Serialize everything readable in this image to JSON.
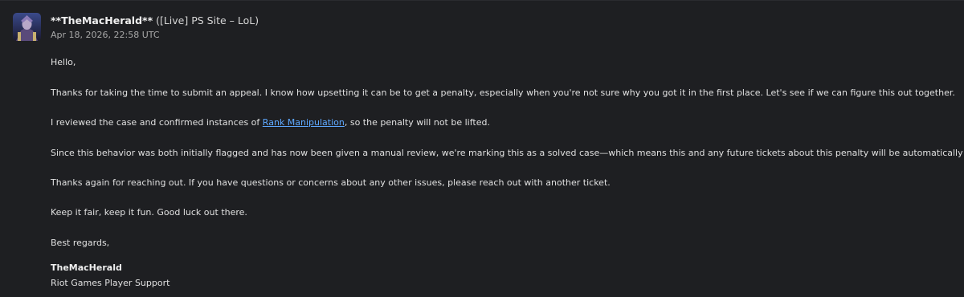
{
  "message": {
    "author": "**TheMacHerald**",
    "site": "([Live] PS Site – LoL)",
    "timestamp": "Apr 18, 2026, 22:58 UTC",
    "avatar_icon": "champion-portrait-icon",
    "greeting": "Hello,",
    "para_intro": "Thanks for taking the time to submit an appeal. I know how upsetting it can be to get a penalty, especially when you're not sure why you got it in the first place. Let's see if we can figure this out together.",
    "para_review_before": "I reviewed the case and confirmed instances of ",
    "para_review_link": "Rank Manipulation",
    "para_review_after": ", so the penalty will not be lifted.",
    "para_solved": "Since this behavior was both initially flagged and has now been given a manual review, we're marking this as a solved case—which means this and any future tickets about this penalty will be automatically closed.",
    "para_thanks": "Thanks again for reaching out. If you have questions or concerns about any other issues, please reach out with another ticket.",
    "para_fair": "Keep it fair, keep it fun. Good luck out there.",
    "closing": "Best regards,",
    "signature_name": "TheMacHerald",
    "signature_org": "Riot Games Player Support"
  },
  "colors": {
    "background": "#1e1f22",
    "text": "#e0e0e0",
    "link": "#5ea8ff",
    "timestamp": "#a8a8a8"
  }
}
